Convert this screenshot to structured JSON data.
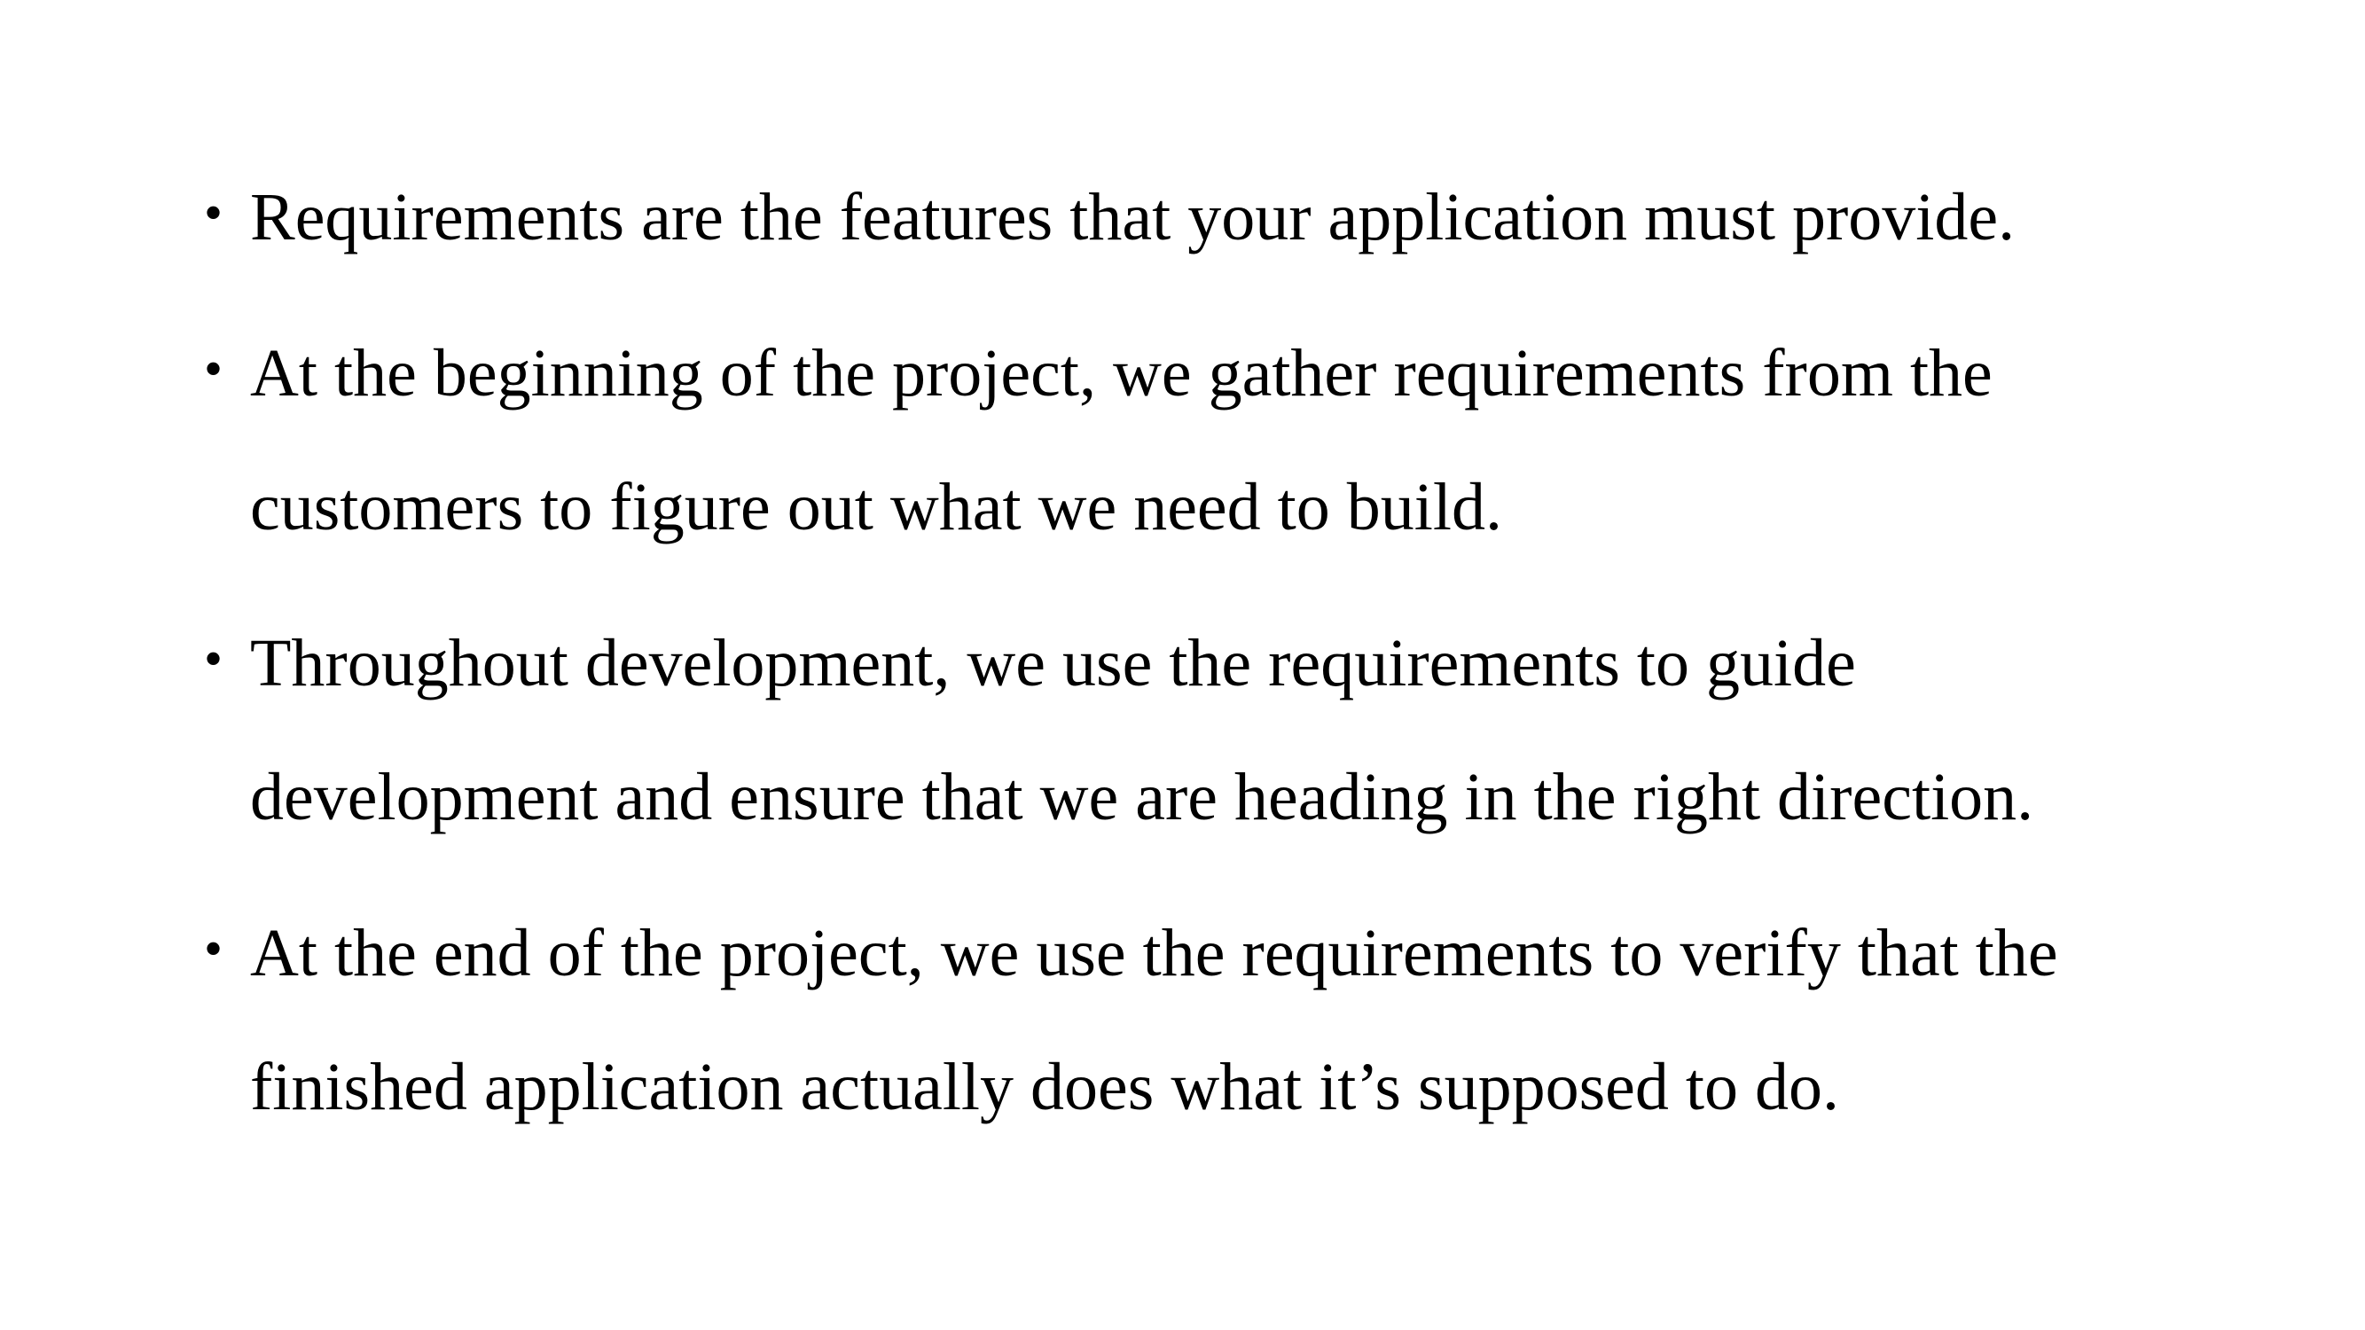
{
  "slide": {
    "bullet_symbol": "•",
    "bullets": [
      {
        "lines": [
          "Requirements are the features that your application must provide."
        ]
      },
      {
        "lines": [
          "At the beginning of the project, we gather requirements from the",
          "customers to figure out what we need to build."
        ]
      },
      {
        "lines": [
          "Throughout development, we use the requirements to guide",
          "development and ensure that we are heading in the right direction."
        ]
      },
      {
        "lines": [
          "At the end of the project, we use the requirements to verify that the",
          "finished application actually does what it’s supposed to do."
        ]
      }
    ]
  }
}
